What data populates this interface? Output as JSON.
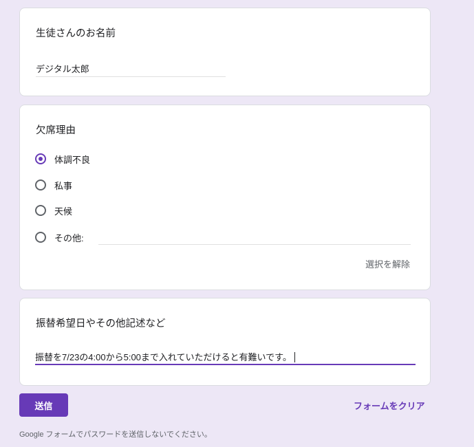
{
  "name_question": {
    "title": "生徒さんのお名前",
    "answer": "デジタル太郎"
  },
  "reason_question": {
    "title": "欠席理由",
    "options": [
      {
        "label": "体調不良",
        "checked": true
      },
      {
        "label": "私事",
        "checked": false
      },
      {
        "label": "天候",
        "checked": false
      },
      {
        "label": "その他:",
        "checked": false
      }
    ],
    "clear_label": "選択を解除"
  },
  "note_question": {
    "title": "振替希望日やその他記述など",
    "answer": "振替を7/23の4:00から5:00まで入れていただけると有難いです。"
  },
  "actions": {
    "submit_label": "送信",
    "clear_form_label": "フォームをクリア"
  },
  "footer": {
    "note": "Google フォームでパスワードを送信しないでください。"
  },
  "colors": {
    "accent": "#673ab7",
    "background": "#ede7f6"
  }
}
